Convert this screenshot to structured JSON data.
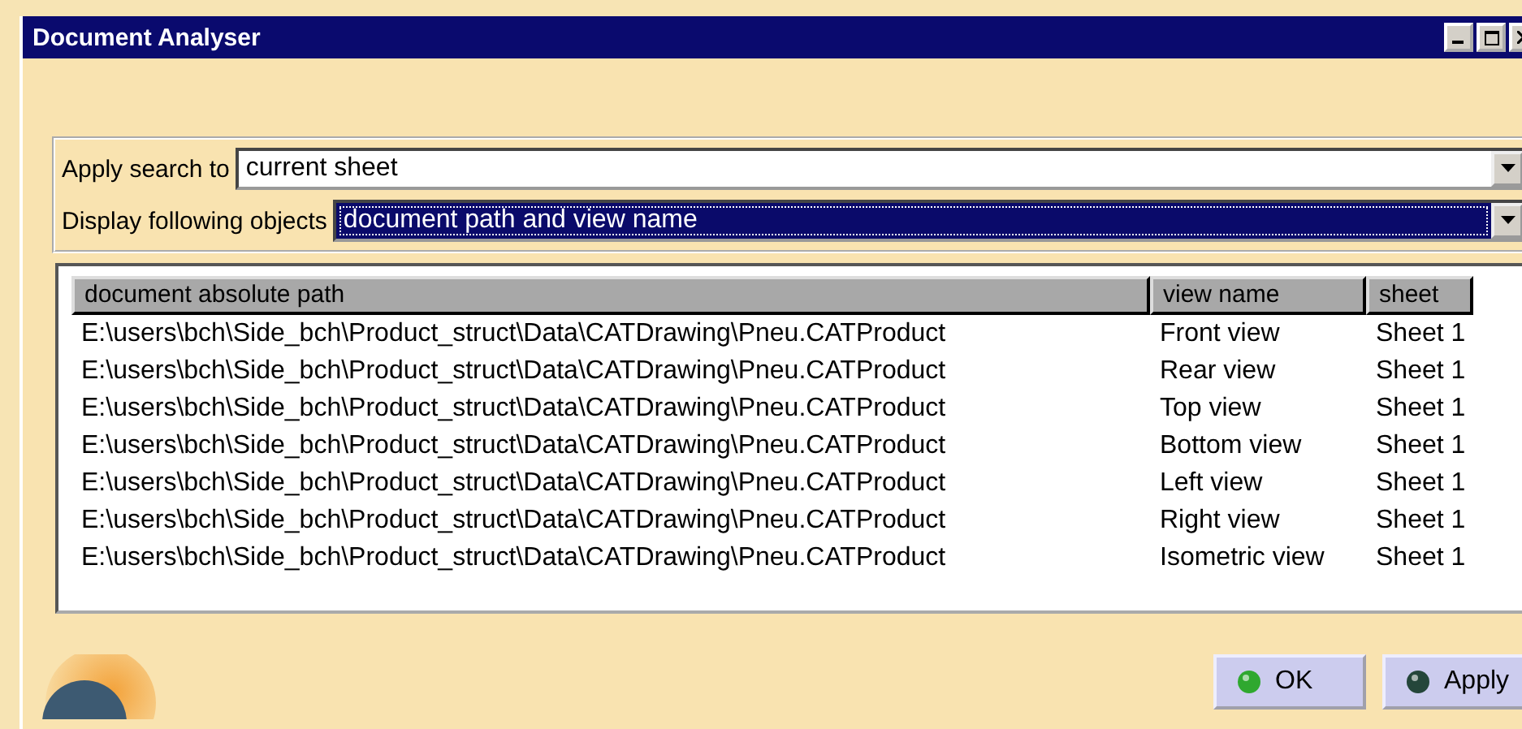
{
  "window": {
    "title": "Document Analyser"
  },
  "fields": [
    {
      "label": "Apply search to",
      "value": "current sheet",
      "highlighted": false
    },
    {
      "label": "Display following objects",
      "value": "document path and view name",
      "highlighted": true
    }
  ],
  "table": {
    "columns": [
      "document absolute path",
      "view name",
      "sheet"
    ],
    "rows": [
      [
        "E:\\users\\bch\\Side_bch\\Product_struct\\Data\\CATDrawing\\Pneu.CATProduct",
        "Front view",
        "Sheet 1"
      ],
      [
        "E:\\users\\bch\\Side_bch\\Product_struct\\Data\\CATDrawing\\Pneu.CATProduct",
        "Rear view",
        "Sheet 1"
      ],
      [
        "E:\\users\\bch\\Side_bch\\Product_struct\\Data\\CATDrawing\\Pneu.CATProduct",
        "Top view",
        "Sheet 1"
      ],
      [
        "E:\\users\\bch\\Side_bch\\Product_struct\\Data\\CATDrawing\\Pneu.CATProduct",
        "Bottom view",
        "Sheet 1"
      ],
      [
        "E:\\users\\bch\\Side_bch\\Product_struct\\Data\\CATDrawing\\Pneu.CATProduct",
        "Left view",
        "Sheet 1"
      ],
      [
        "E:\\users\\bch\\Side_bch\\Product_struct\\Data\\CATDrawing\\Pneu.CATProduct",
        "Right view",
        "Sheet 1"
      ],
      [
        "E:\\users\\bch\\Side_bch\\Product_struct\\Data\\CATDrawing\\Pneu.CATProduct",
        "Isometric view",
        "Sheet 1"
      ]
    ]
  },
  "buttons": [
    {
      "label": "OK",
      "color": "#2fa82f"
    },
    {
      "label": "Apply",
      "color": "#24463a"
    }
  ]
}
